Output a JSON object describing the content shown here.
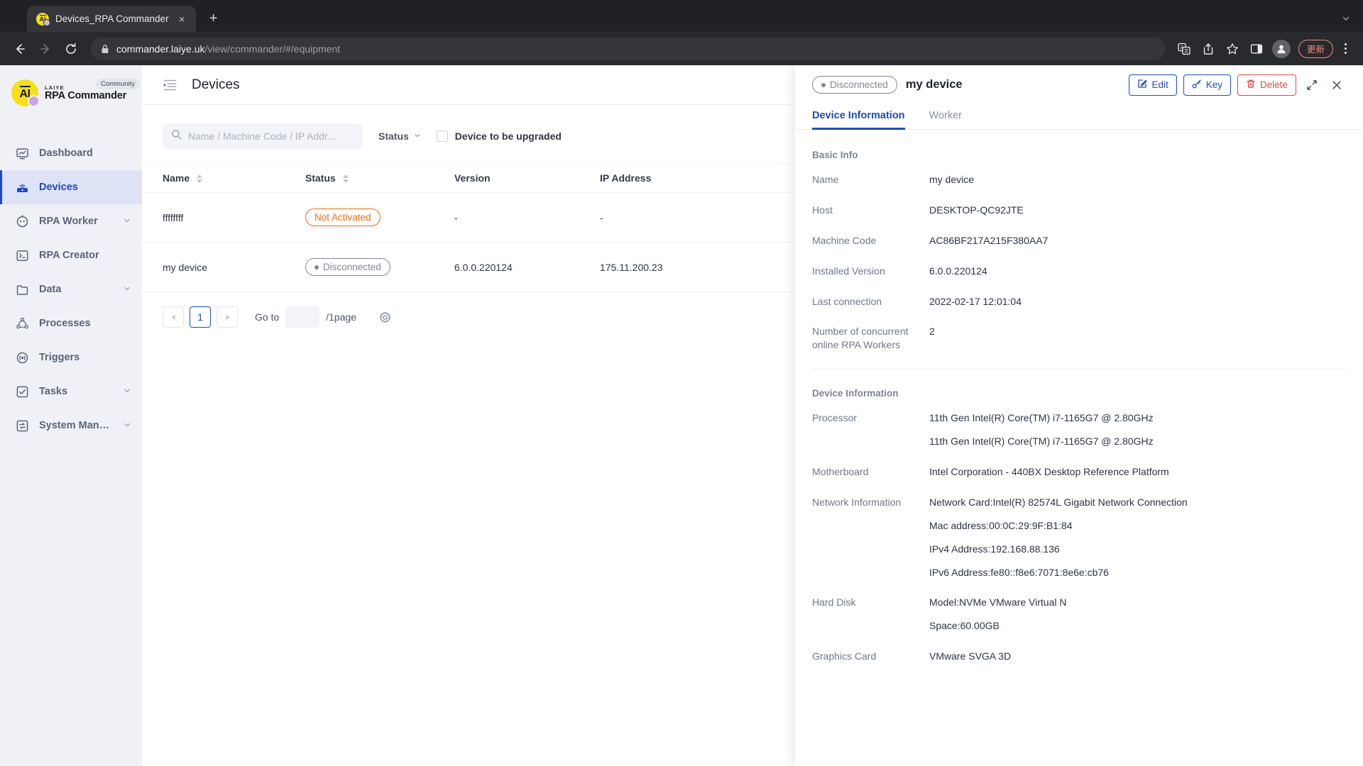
{
  "browser": {
    "tab": {
      "title": "Devices_RPA Commander",
      "favicon": "laiye-ai-icon",
      "close": "×"
    },
    "new_tab_label": "+",
    "tabstrip_chevron": "chevron-down-icon",
    "url": {
      "host": "commander.laiye.uk",
      "path": "/view/commander/#/equipment"
    },
    "toolbar_icons": [
      "back-icon",
      "forward-icon",
      "reload-icon",
      "lock-icon",
      "translate-icon",
      "share-icon",
      "bookmark-star-icon",
      "side-panel-icon",
      "profile-avatar-icon"
    ],
    "update_button_label": "更新",
    "menu": "kebab-menu-icon"
  },
  "sidebar": {
    "brand": {
      "logo_text": "AI",
      "company": "LAIYE",
      "product": "RPA Commander",
      "badge": "Community"
    },
    "items": [
      {
        "label": "Dashboard",
        "icon": "dashboard-monitor-icon",
        "active": false,
        "expandable": false
      },
      {
        "label": "Devices",
        "icon": "device-router-icon",
        "active": true,
        "expandable": false
      },
      {
        "label": "RPA Worker",
        "icon": "robot-worker-icon",
        "active": false,
        "expandable": true
      },
      {
        "label": "RPA Creator",
        "icon": "terminal-icon",
        "active": false,
        "expandable": false
      },
      {
        "label": "Data",
        "icon": "folder-icon",
        "active": false,
        "expandable": true
      },
      {
        "label": "Processes",
        "icon": "process-nodes-icon",
        "active": false,
        "expandable": false
      },
      {
        "label": "Triggers",
        "icon": "trigger-signal-icon",
        "active": false,
        "expandable": false
      },
      {
        "label": "Tasks",
        "icon": "checkbox-task-icon",
        "active": false,
        "expandable": true
      },
      {
        "label": "System Manag...",
        "icon": "system-transfer-icon",
        "active": false,
        "expandable": true
      }
    ]
  },
  "main": {
    "collapse_icon": "collapse-sidebar-icon",
    "page_title": "Devices",
    "search": {
      "icon": "search-icon",
      "value": "",
      "placeholder": "Name / Machine Code / IP Addr..."
    },
    "status_filter": {
      "label": "Status",
      "caret": "chevron-down-icon"
    },
    "upgrade_checkbox": {
      "label": "Device to be upgraded",
      "checked": false
    },
    "table": {
      "columns": [
        {
          "label": "Name",
          "sortable": true
        },
        {
          "label": "Status",
          "sortable": true
        },
        {
          "label": "Version",
          "sortable": false
        },
        {
          "label": "IP Address",
          "sortable": false
        }
      ],
      "rows": [
        {
          "name": "ffffffff",
          "status": "Not Activated",
          "status_kind": "orange",
          "status_dot": false,
          "version": "-",
          "ip": "-"
        },
        {
          "name": "my device",
          "status": "Disconnected",
          "status_kind": "gray",
          "status_dot": true,
          "version": "6.0.0.220124",
          "ip": "175.11.200.23"
        }
      ]
    },
    "pagination": {
      "prev": "◀",
      "page": "1",
      "next": "▶",
      "goto_label": "Go to",
      "goto_value": "",
      "per_page_label": "/1page",
      "settings_icon": "gear-icon"
    }
  },
  "detail_panel": {
    "status_badge": {
      "label": "Disconnected",
      "kind": "gray"
    },
    "title": "my device",
    "buttons": [
      {
        "label": "Edit",
        "icon": "edit-pencil-icon",
        "kind": "blue"
      },
      {
        "label": "Key",
        "icon": "key-icon",
        "kind": "blue"
      },
      {
        "label": "Delete",
        "icon": "trash-icon",
        "kind": "red"
      }
    ],
    "expand_icon": "expand-diagonal-icon",
    "close_icon": "close-icon",
    "tabs": [
      {
        "label": "Device Information",
        "active": true
      },
      {
        "label": "Worker",
        "active": false
      }
    ],
    "basic_info": {
      "section_title": "Basic Info",
      "rows": [
        {
          "label": "Name",
          "values": [
            "my device"
          ]
        },
        {
          "label": "Host",
          "values": [
            "DESKTOP-QC92JTE"
          ]
        },
        {
          "label": "Machine Code",
          "values": [
            "AC86BF217A215F380AA7"
          ]
        },
        {
          "label": "Installed Version",
          "values": [
            "6.0.0.220124"
          ]
        },
        {
          "label": "Last connection",
          "values": [
            "2022-02-17 12:01:04"
          ]
        },
        {
          "label": "Number of concurrent online RPA Workers",
          "values": [
            "2"
          ]
        }
      ]
    },
    "device_info": {
      "section_title": "Device Information",
      "rows": [
        {
          "label": "Processor",
          "values": [
            "11th Gen Intel(R) Core(TM) i7-1165G7 @ 2.80GHz",
            "11th Gen Intel(R) Core(TM) i7-1165G7 @ 2.80GHz"
          ]
        },
        {
          "label": "Motherboard",
          "values": [
            "Intel Corporation - 440BX Desktop Reference Platform"
          ]
        },
        {
          "label": "Network Information",
          "values": [
            "Network Card:Intel(R) 82574L Gigabit Network Connection",
            "Mac address:00:0C:29:9F:B1:84",
            "IPv4 Address:192.168.88.136",
            "IPv6 Address:fe80::f8e6:7071:8e6e:cb76"
          ]
        },
        {
          "label": "Hard Disk",
          "values": [
            "Model:NVMe VMware Virtual N",
            "Space:60.00GB"
          ]
        },
        {
          "label": "Graphics Card",
          "values": [
            "VMware SVGA 3D"
          ]
        }
      ]
    }
  },
  "colors": {
    "accent_blue": "#1d49d0",
    "orange": "#f4690a",
    "danger_red": "#e8443a",
    "sidebar_bg": "#eff1f6",
    "brand_yellow": "#f7e017"
  }
}
